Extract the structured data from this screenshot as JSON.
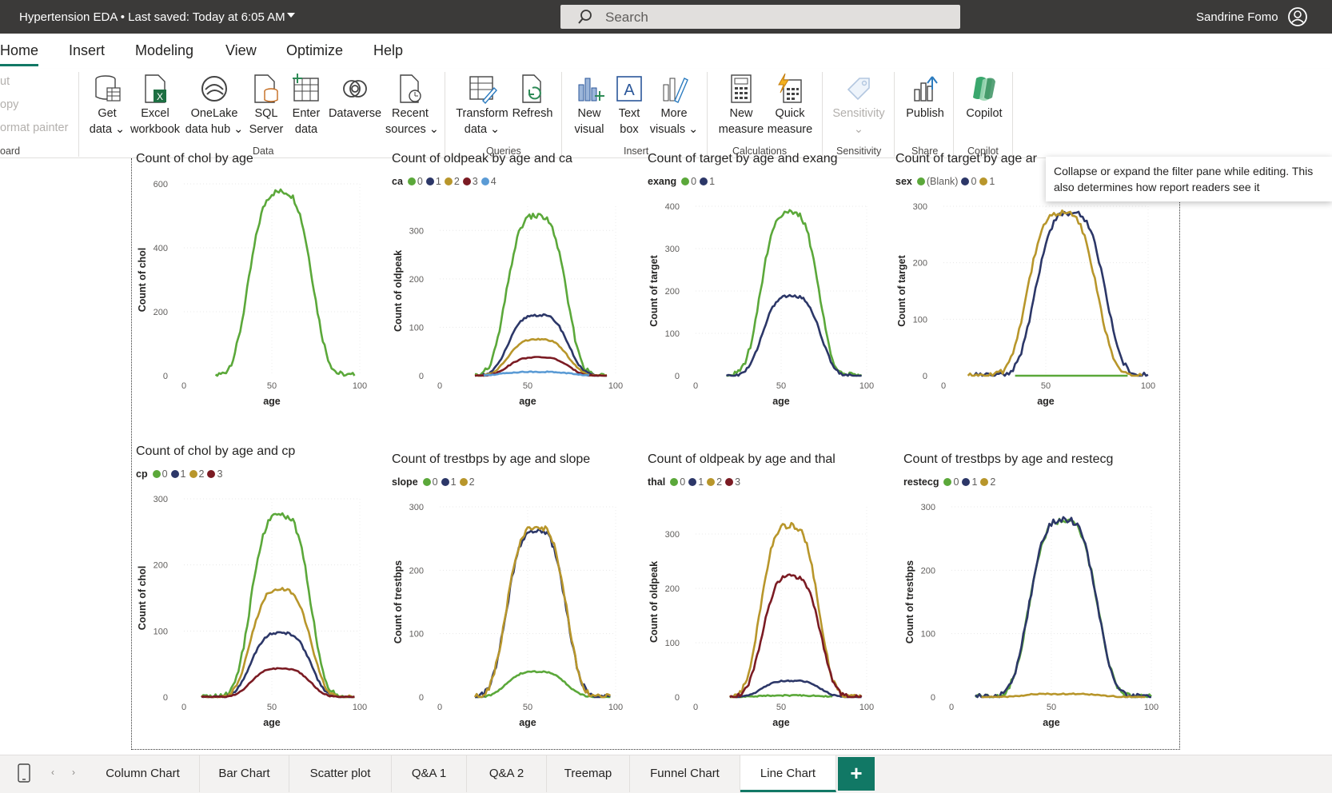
{
  "titlebar": {
    "file_title": "Hypertension EDA • Last saved: Today at 6:05 AM",
    "search_placeholder": "Search",
    "user_name": "Sandrine Fomo"
  },
  "menu": {
    "tabs": [
      "Home",
      "Insert",
      "Modeling",
      "View",
      "Optimize",
      "Help"
    ],
    "active": "Home"
  },
  "ribbon": {
    "clipboard_items": [
      "ut",
      "opy",
      "ormat painter"
    ],
    "clipboard_label": "oard",
    "buttons": {
      "get_data": [
        "Get",
        "data ⌄"
      ],
      "excel": [
        "Excel",
        "workbook"
      ],
      "onelake": [
        "OneLake",
        "data hub ⌄"
      ],
      "sql": [
        "SQL",
        "Server"
      ],
      "enter_data": [
        "Enter",
        "data"
      ],
      "dataverse": [
        "Dataverse",
        ""
      ],
      "recent": [
        "Recent",
        "sources ⌄"
      ],
      "transform": [
        "Transform",
        "data ⌄"
      ],
      "refresh": [
        "Refresh",
        ""
      ],
      "new_visual": [
        "New",
        "visual"
      ],
      "text_box": [
        "Text",
        "box"
      ],
      "more_visuals": [
        "More",
        "visuals ⌄"
      ],
      "new_measure": [
        "New",
        "measure"
      ],
      "quick_measure": [
        "Quick",
        "measure"
      ],
      "sensitivity": [
        "Sensitivity",
        "⌄"
      ],
      "publish": [
        "Publish",
        ""
      ],
      "copilot": [
        "Copilot",
        ""
      ]
    },
    "groups": {
      "data": "Data",
      "queries": "Queries",
      "insert": "Insert",
      "calculations": "Calculations",
      "sensitivity": "Sensitivity",
      "share": "Share",
      "copilot": "Copilot"
    }
  },
  "tooltip": "Collapse or expand the filter pane while editing. This also determines how report readers see it",
  "colors": {
    "green": "#5ba83a",
    "navy": "#2c3768",
    "gold": "#b8962b",
    "maroon": "#7b1b23",
    "lightblue": "#5b9bd5",
    "teal": "#117865"
  },
  "charts": [
    {
      "title": "Count of chol by age",
      "legend_title": "",
      "legend": [],
      "ylabel": "Count of chol",
      "xlabel": "age",
      "yticks": [
        0,
        200,
        400,
        600
      ],
      "xticks": [
        "0",
        "50",
        "100"
      ],
      "chart_data": {
        "type": "line",
        "title": "Count of chol by age",
        "xlabel": "age",
        "ylabel": "Count of chol",
        "xlim": [
          0,
          100
        ],
        "ylim": [
          0,
          600
        ],
        "series": [
          {
            "color": "#5ba83a",
            "peak": 575,
            "center": 55,
            "width": 18,
            "start": 18,
            "end": 97
          }
        ]
      }
    },
    {
      "title": "Count of oldpeak by age and ca",
      "legend_title": "ca",
      "legend": [
        [
          "0",
          "#5ba83a"
        ],
        [
          "1",
          "#2c3768"
        ],
        [
          "2",
          "#b8962b"
        ],
        [
          "3",
          "#7b1b23"
        ],
        [
          "4",
          "#5b9bd5"
        ]
      ],
      "ylabel": "Count of oldpeak",
      "xlabel": "age",
      "yticks": [
        0,
        100,
        200,
        300
      ],
      "xticks": [
        "0",
        "50",
        "100"
      ],
      "chart_data": {
        "type": "line",
        "title": "Count of oldpeak by age and ca",
        "xlabel": "age",
        "ylabel": "Count of oldpeak",
        "xlim": [
          0,
          100
        ],
        "ylim": [
          0,
          350
        ],
        "series": [
          {
            "name": "0",
            "color": "#5ba83a",
            "peak": 330,
            "center": 55,
            "width": 17,
            "start": 20,
            "end": 95
          },
          {
            "name": "1",
            "color": "#2c3768",
            "peak": 125,
            "center": 56,
            "width": 17,
            "start": 20,
            "end": 95
          },
          {
            "name": "2",
            "color": "#b8962b",
            "peak": 75,
            "center": 56,
            "width": 17,
            "start": 20,
            "end": 95
          },
          {
            "name": "3",
            "color": "#7b1b23",
            "peak": 38,
            "center": 56,
            "width": 17,
            "start": 20,
            "end": 95
          },
          {
            "name": "4",
            "color": "#5b9bd5",
            "peak": 8,
            "center": 55,
            "width": 20,
            "start": 25,
            "end": 85
          }
        ]
      }
    },
    {
      "title": "Count of target by age and exang",
      "legend_title": "exang",
      "legend": [
        [
          "0",
          "#5ba83a"
        ],
        [
          "1",
          "#2c3768"
        ]
      ],
      "ylabel": "Count of target",
      "xlabel": "age",
      "yticks": [
        0,
        100,
        200,
        300,
        400
      ],
      "xticks": [
        "0",
        "50",
        "100"
      ],
      "chart_data": {
        "type": "line",
        "title": "Count of target by age and exang",
        "xlabel": "age",
        "ylabel": "Count of target",
        "xlim": [
          0,
          100
        ],
        "ylim": [
          0,
          400
        ],
        "series": [
          {
            "name": "0",
            "color": "#5ba83a",
            "peak": 385,
            "center": 55,
            "width": 17,
            "start": 18,
            "end": 97
          },
          {
            "name": "1",
            "color": "#2c3768",
            "peak": 188,
            "center": 56,
            "width": 17,
            "start": 18,
            "end": 97
          }
        ]
      }
    },
    {
      "title": "Count of target by age ar",
      "legend_title": "sex",
      "legend": [
        [
          "(Blank)",
          "#5ba83a"
        ],
        [
          "0",
          "#2c3768"
        ],
        [
          "1",
          "#b8962b"
        ]
      ],
      "ylabel": "Count of target",
      "xlabel": "age",
      "yticks": [
        0,
        100,
        200,
        300
      ],
      "xticks": [
        "0",
        "50",
        "100"
      ],
      "chart_data": {
        "type": "line",
        "title": "Count of target by age ar",
        "xlabel": "age",
        "ylabel": "Count of target",
        "xlim": [
          0,
          100
        ],
        "ylim": [
          0,
          300
        ],
        "series": [
          {
            "name": "(Blank)",
            "color": "#5ba83a",
            "flat": 0,
            "start": 35,
            "end": 90
          },
          {
            "name": "0",
            "color": "#2c3768",
            "peak": 288,
            "center": 62,
            "width": 17,
            "start": 15,
            "end": 100
          },
          {
            "name": "1",
            "color": "#b8962b",
            "peak": 288,
            "center": 58,
            "width": 17,
            "start": 12,
            "end": 97
          }
        ]
      }
    },
    {
      "title": "Count of chol by age and cp",
      "legend_title": "cp",
      "legend": [
        [
          "0",
          "#5ba83a"
        ],
        [
          "1",
          "#2c3768"
        ],
        [
          "2",
          "#b8962b"
        ],
        [
          "3",
          "#7b1b23"
        ]
      ],
      "ylabel": "Count of chol",
      "xlabel": "age",
      "yticks": [
        0,
        100,
        200,
        300
      ],
      "xticks": [
        "0",
        "50",
        "100"
      ],
      "chart_data": {
        "type": "line",
        "title": "Count of chol by age and cp",
        "xlabel": "age",
        "ylabel": "Count of chol",
        "xlim": [
          0,
          100
        ],
        "ylim": [
          0,
          300
        ],
        "series": [
          {
            "name": "0",
            "color": "#5ba83a",
            "peak": 275,
            "center": 55,
            "width": 17,
            "start": 10,
            "end": 97
          },
          {
            "name": "1",
            "color": "#2c3768",
            "peak": 97,
            "center": 55,
            "width": 17,
            "start": 10,
            "end": 97
          },
          {
            "name": "2",
            "color": "#b8962b",
            "peak": 163,
            "center": 55,
            "width": 17,
            "start": 10,
            "end": 97
          },
          {
            "name": "3",
            "color": "#7b1b23",
            "peak": 43,
            "center": 55,
            "width": 17,
            "start": 10,
            "end": 97
          }
        ]
      }
    },
    {
      "title": "Count of trestbps by age and slope",
      "legend_title": "slope",
      "legend": [
        [
          "0",
          "#5ba83a"
        ],
        [
          "1",
          "#2c3768"
        ],
        [
          "2",
          "#b8962b"
        ]
      ],
      "ylabel": "Count of trestbps",
      "xlabel": "age",
      "yticks": [
        0,
        100,
        200,
        300
      ],
      "xticks": [
        "0",
        "50",
        "100"
      ],
      "chart_data": {
        "type": "line",
        "title": "Count of trestbps by age and slope",
        "xlabel": "age",
        "ylabel": "Count of trestbps",
        "xlim": [
          0,
          100
        ],
        "ylim": [
          0,
          300
        ],
        "series": [
          {
            "name": "0",
            "color": "#5ba83a",
            "peak": 40,
            "center": 55,
            "width": 17,
            "start": 20,
            "end": 97
          },
          {
            "name": "1",
            "color": "#2c3768",
            "peak": 262,
            "center": 55,
            "width": 17,
            "start": 20,
            "end": 97
          },
          {
            "name": "2",
            "color": "#b8962b",
            "peak": 268,
            "center": 55,
            "width": 17,
            "start": 20,
            "end": 97
          }
        ]
      }
    },
    {
      "title": "Count of oldpeak by age and thal",
      "legend_title": "thal",
      "legend": [
        [
          "0",
          "#5ba83a"
        ],
        [
          "1",
          "#2c3768"
        ],
        [
          "2",
          "#b8962b"
        ],
        [
          "3",
          "#7b1b23"
        ]
      ],
      "ylabel": "Count of oldpeak",
      "xlabel": "age",
      "yticks": [
        0,
        100,
        200,
        300
      ],
      "xticks": [
        "0",
        "50",
        "100"
      ],
      "chart_data": {
        "type": "line",
        "title": "Count of oldpeak by age and thal",
        "xlabel": "age",
        "ylabel": "Count of oldpeak",
        "xlim": [
          0,
          100
        ],
        "ylim": [
          0,
          350
        ],
        "series": [
          {
            "name": "0",
            "color": "#5ba83a",
            "peak": 3,
            "center": 55,
            "width": 20,
            "start": 20,
            "end": 80
          },
          {
            "name": "1",
            "color": "#2c3768",
            "peak": 30,
            "center": 56,
            "width": 17,
            "start": 20,
            "end": 97
          },
          {
            "name": "2",
            "color": "#b8962b",
            "peak": 315,
            "center": 55,
            "width": 17,
            "start": 20,
            "end": 97
          },
          {
            "name": "3",
            "color": "#7b1b23",
            "peak": 222,
            "center": 56,
            "width": 17,
            "start": 20,
            "end": 97
          }
        ]
      }
    },
    {
      "title": "Count of trestbps by age and restecg",
      "legend_title": "restecg",
      "legend": [
        [
          "0",
          "#5ba83a"
        ],
        [
          "1",
          "#2c3768"
        ],
        [
          "2",
          "#b8962b"
        ]
      ],
      "ylabel": "Count of trestbps",
      "xlabel": "age",
      "yticks": [
        0,
        100,
        200,
        300
      ],
      "xticks": [
        "0",
        "50",
        "100"
      ],
      "chart_data": {
        "type": "line",
        "title": "Count of trestbps by age and restecg",
        "xlabel": "age",
        "ylabel": "Count of trestbps",
        "xlim": [
          0,
          100
        ],
        "ylim": [
          0,
          300
        ],
        "series": [
          {
            "name": "0",
            "color": "#5ba83a",
            "peak": 278,
            "center": 56,
            "width": 17,
            "start": 12,
            "end": 100
          },
          {
            "name": "1",
            "color": "#2c3768",
            "peak": 280,
            "center": 56,
            "width": 17,
            "start": 12,
            "end": 100
          },
          {
            "name": "2",
            "color": "#b8962b",
            "peak": 5,
            "center": 55,
            "width": 20,
            "start": 15,
            "end": 97
          }
        ]
      }
    }
  ],
  "page_tabs": [
    "Column Chart",
    "Bar Chart",
    "Scatter plot",
    "Q&A 1",
    "Q&A 2",
    "Treemap",
    "Funnel Chart",
    "Line Chart"
  ],
  "active_page": "Line Chart",
  "add_page_label": "+"
}
